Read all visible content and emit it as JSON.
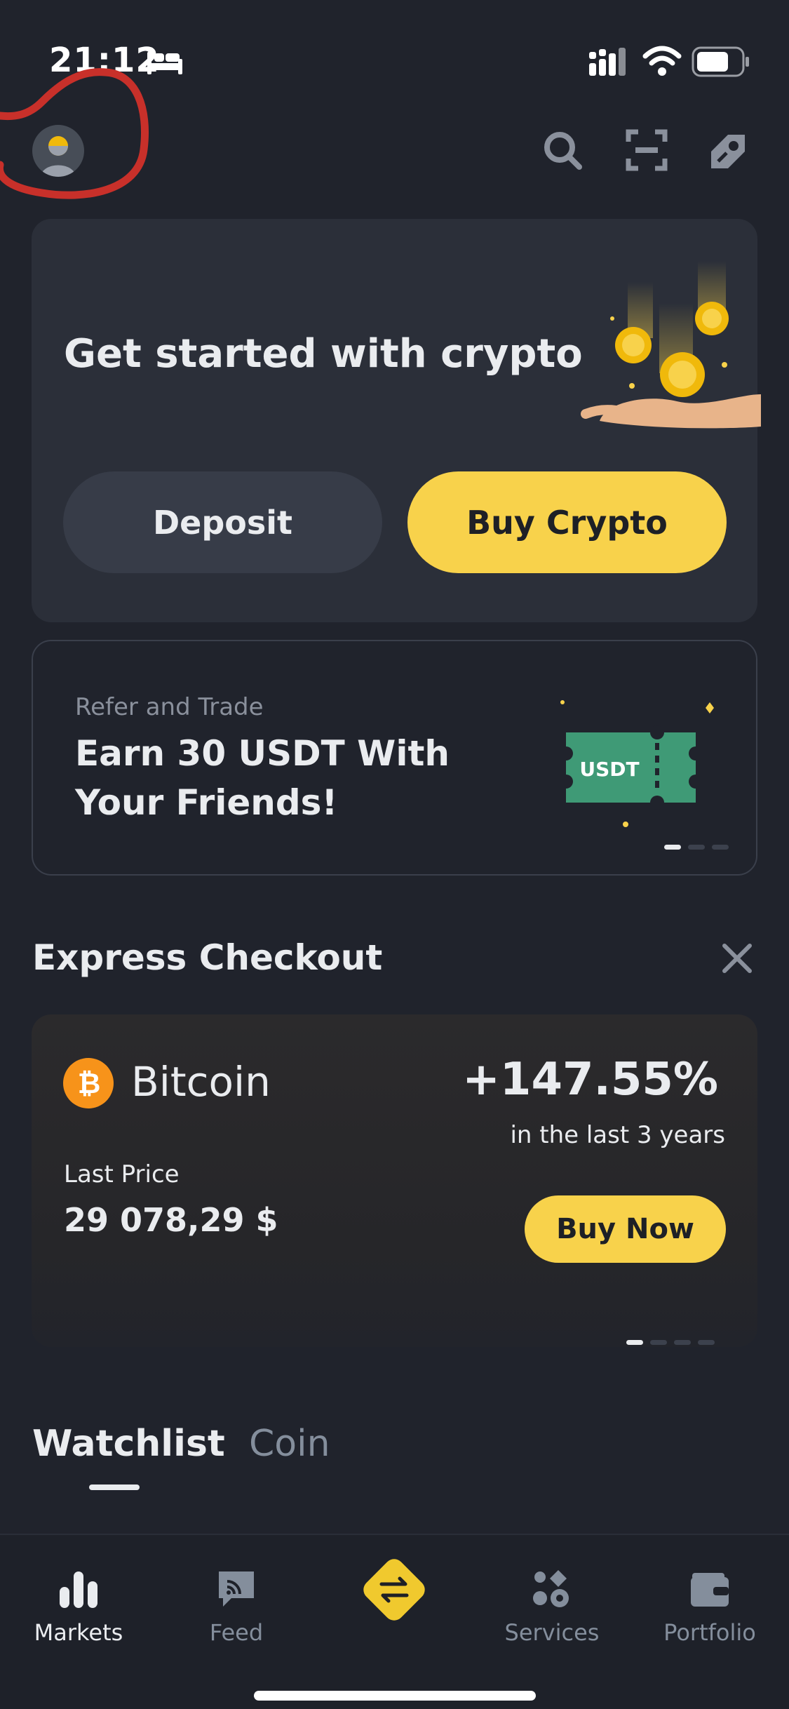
{
  "status_bar": {
    "time": "21:12",
    "icons": [
      "bed-icon",
      "signal-icon",
      "wifi-icon",
      "battery-icon"
    ]
  },
  "header": {
    "icons": [
      "avatar",
      "search-icon",
      "scan-icon",
      "referral-icon"
    ]
  },
  "get_started": {
    "title": "Get started with crypto",
    "deposit_label": "Deposit",
    "buy_crypto_label": "Buy Crypto"
  },
  "refer_banner": {
    "subtitle": "Refer and Trade",
    "title": "Earn 30 USDT With Your Friends!",
    "ticket_text": "USDT",
    "pages": 3,
    "active_page": 1
  },
  "express_checkout": {
    "title": "Express Checkout",
    "coin_name": "Bitcoin",
    "change": "+147.55%",
    "change_period": "in the last 3 years",
    "price_label": "Last Price",
    "price_value": "29 078,29 $",
    "buy_now_label": "Buy Now",
    "pages": 4,
    "active_page": 1
  },
  "tabs": [
    {
      "label": "Watchlist",
      "active": true
    },
    {
      "label": "Coin",
      "active": false
    }
  ],
  "bottom_nav": {
    "items": [
      {
        "label": "Markets",
        "icon": "bar-chart-icon",
        "active": true
      },
      {
        "label": "Feed",
        "icon": "feed-icon",
        "active": false
      },
      {
        "label": "",
        "icon": "trade-swap-icon",
        "active": false
      },
      {
        "label": "Services",
        "icon": "services-icon",
        "active": false
      },
      {
        "label": "Portfolio",
        "icon": "wallet-icon",
        "active": false
      }
    ]
  },
  "colors": {
    "background": "#20232c",
    "card": "#2b2f39",
    "accent_yellow": "#f8d24b",
    "text_primary": "#eaecef",
    "text_secondary": "#848e9c",
    "annotation_red": "#c8302a"
  }
}
